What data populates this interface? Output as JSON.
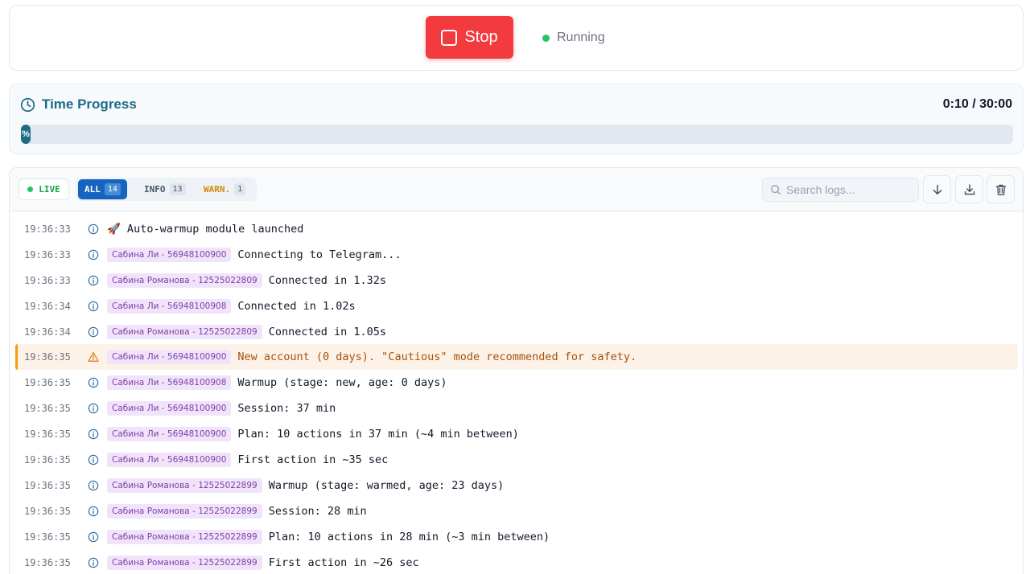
{
  "controls": {
    "stop_label": "Stop",
    "status_text": "Running",
    "status_color": "#22c55e",
    "stop_color": "#f23a3f"
  },
  "time_progress": {
    "title": "Time Progress",
    "elapsed": "0:10",
    "total": "30:00",
    "readout": "0:10 / 30:00",
    "percent_label": "%",
    "progress_fraction": 0.0056
  },
  "log_toolbar": {
    "live_label": "LIVE",
    "filters": [
      {
        "label": "ALL",
        "count": "14",
        "active": true
      },
      {
        "label": "INFO",
        "count": "13",
        "active": false
      },
      {
        "label": "WARN.",
        "count": "1",
        "active": false
      }
    ],
    "search_placeholder": "Search logs...",
    "icons": [
      "scroll-down-icon",
      "download-icon",
      "trash-icon"
    ]
  },
  "logs": [
    {
      "time": "19:36:33",
      "level": "info",
      "tag": "",
      "message": "🚀 Auto-warmup module launched"
    },
    {
      "time": "19:36:33",
      "level": "info",
      "tag": "Сабина Ли - 56948100900",
      "message": "Connecting to Telegram..."
    },
    {
      "time": "19:36:33",
      "level": "info",
      "tag": "Сабина Романова - 12525022809",
      "message": "Connected in 1.32s"
    },
    {
      "time": "19:36:34",
      "level": "info",
      "tag": "Сабина Ли - 56948100908",
      "message": "Connected in 1.02s"
    },
    {
      "time": "19:36:34",
      "level": "info",
      "tag": "Сабина Романова - 12525022809",
      "message": "Connected in 1.05s"
    },
    {
      "time": "19:36:35",
      "level": "warn",
      "tag": "Сабина Ли - 56948100900",
      "message": "New account (0 days). \"Cautious\" mode recommended for safety."
    },
    {
      "time": "19:36:35",
      "level": "info",
      "tag": "Сабина Ли - 56948100908",
      "message": "Warmup (stage: new, age: 0 days)"
    },
    {
      "time": "19:36:35",
      "level": "info",
      "tag": "Сабина Ли - 56948100900",
      "message": "Session: 37 min"
    },
    {
      "time": "19:36:35",
      "level": "info",
      "tag": "Сабина Ли - 56948100900",
      "message": "Plan: 10 actions in 37 min (~4 min between)"
    },
    {
      "time": "19:36:35",
      "level": "info",
      "tag": "Сабина Ли - 56948100900",
      "message": "First action in ~35 sec"
    },
    {
      "time": "19:36:35",
      "level": "info",
      "tag": "Сабина Романова - 12525022899",
      "message": "Warmup (stage: warmed, age: 23 days)"
    },
    {
      "time": "19:36:35",
      "level": "info",
      "tag": "Сабина Романова - 12525022899",
      "message": "Session: 28 min"
    },
    {
      "time": "19:36:35",
      "level": "info",
      "tag": "Сабина Романова - 12525022899",
      "message": "Plan: 10 actions in 28 min (~3 min between)"
    },
    {
      "time": "19:36:35",
      "level": "info",
      "tag": "Сабина Романова - 12525022899",
      "message": "First action in ~26 sec"
    }
  ]
}
